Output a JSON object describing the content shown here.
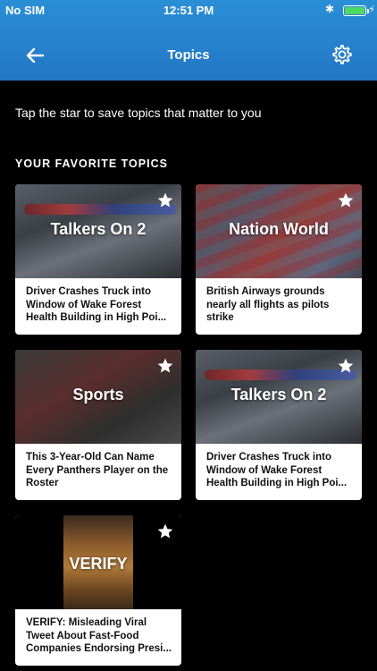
{
  "status_bar": {
    "carrier": "No SIM",
    "time": "12:51 PM",
    "bluetooth": "✱",
    "battery_level": 1.0,
    "battery_color": "#4cd964"
  },
  "nav": {
    "title": "Topics",
    "back_icon": "back-arrow-icon",
    "settings_icon": "gear-icon"
  },
  "intro_text": "Tap the star to save topics that matter to you",
  "section_title": "YOUR FAVORITE TOPICS",
  "cards": [
    {
      "topic": "Talkers On 2",
      "headline": "Driver Crashes Truck into Window of Wake Forest Health Building in High Poi...",
      "starred": true
    },
    {
      "topic": "Nation World",
      "headline": "British Airways grounds nearly all flights as pilots strike",
      "starred": true
    },
    {
      "topic": "Sports",
      "headline": "This 3-Year-Old Can Name Every Panthers Player on the Roster",
      "starred": true
    },
    {
      "topic": "Talkers On 2",
      "headline": "Driver Crashes Truck into Window of Wake Forest Health Building in High Poi...",
      "starred": true
    },
    {
      "topic": "VERIFY",
      "headline": "VERIFY: Misleading Viral Tweet About Fast-Food Companies Endorsing Presi...",
      "starred": true
    }
  ],
  "colors": {
    "header_gradient_top": "#2a8fd6",
    "header_gradient_bottom": "#2376c4",
    "background": "#000000",
    "card_body": "#ffffff"
  }
}
